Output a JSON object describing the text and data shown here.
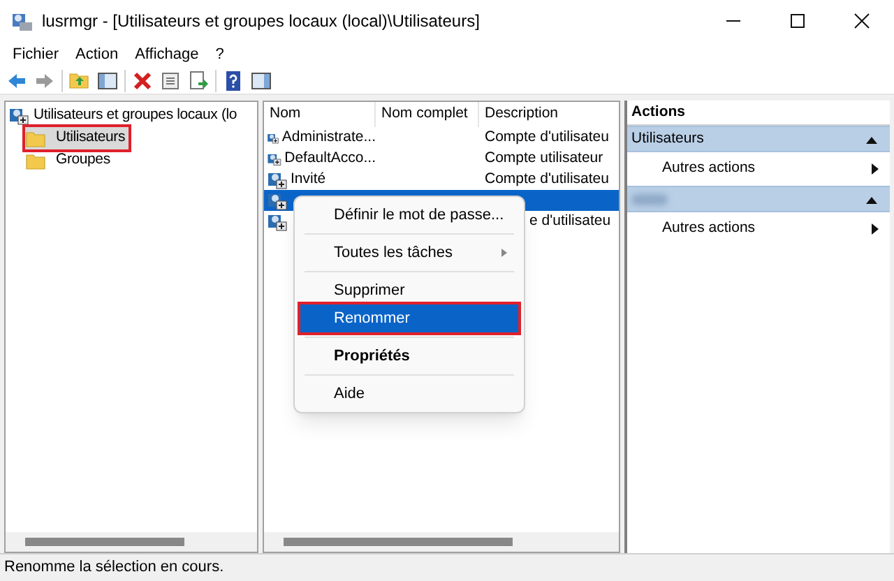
{
  "window": {
    "title": "lusrmgr - [Utilisateurs et groupes locaux (local)\\Utilisateurs]"
  },
  "menu": [
    "Fichier",
    "Action",
    "Affichage",
    "?"
  ],
  "tree": {
    "label": "Utilisateurs et groupes locaux (lo",
    "expanded": true,
    "children": [
      {
        "label": "Utilisateurs",
        "selected": true,
        "highlighted": true
      },
      {
        "label": "Groupes",
        "selected": false,
        "highlighted": false
      }
    ]
  },
  "table": {
    "columns": [
      "Nom",
      "Nom complet",
      "Description"
    ],
    "rows": [
      {
        "name": "Administrate...",
        "full_name": "",
        "description": "Compte d'utilisateu",
        "selected": false,
        "kind": "plain"
      },
      {
        "name": "DefaultAcco...",
        "full_name": "",
        "description": "Compte utilisateur",
        "selected": false,
        "kind": "plain"
      },
      {
        "name": "Invité",
        "full_name": "",
        "description": "Compte d'utilisateu",
        "selected": false,
        "kind": "plain"
      },
      {
        "name": "",
        "full_name": "",
        "description": "",
        "selected": true,
        "kind": "plain"
      },
      {
        "name": "",
        "full_name": "",
        "description": "e d'utilisateu",
        "selected": false,
        "kind": "covered"
      }
    ]
  },
  "context_menu": [
    {
      "label": "Définir le mot de passe...",
      "kind": "item",
      "selected": false,
      "highlighted": false
    },
    {
      "kind": "separator"
    },
    {
      "label": "Toutes les tâches",
      "kind": "submenu",
      "selected": false,
      "highlighted": false
    },
    {
      "kind": "separator"
    },
    {
      "label": "Supprimer",
      "kind": "item",
      "selected": false,
      "highlighted": false
    },
    {
      "label": "Renommer",
      "kind": "item",
      "selected": true,
      "highlighted": true
    },
    {
      "kind": "separator"
    },
    {
      "label": "Propriétés",
      "kind": "bold",
      "selected": false,
      "highlighted": false
    },
    {
      "kind": "separator"
    },
    {
      "label": "Aide",
      "kind": "item",
      "selected": false,
      "highlighted": false
    }
  ],
  "actions": {
    "title": "Actions",
    "sections": [
      {
        "title": "Utilisateurs",
        "kind": "plain",
        "items": [
          "Autres actions"
        ]
      },
      {
        "kind": "blurred",
        "items": [
          "Autres actions"
        ]
      }
    ]
  },
  "status_bar": "Renomme la sélection en cours."
}
